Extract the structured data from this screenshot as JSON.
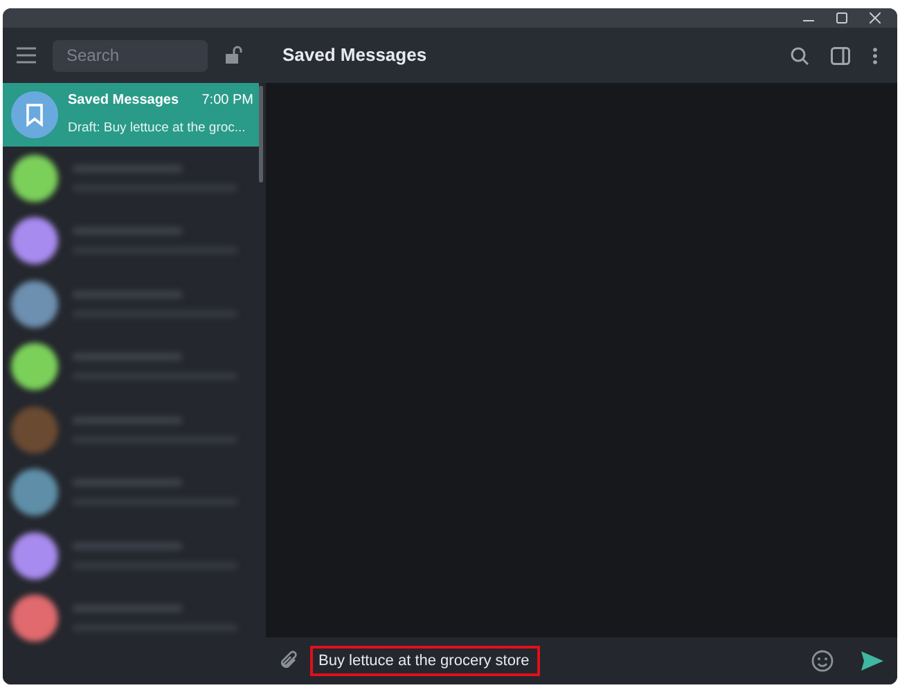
{
  "sidebar": {
    "search": {
      "placeholder": "Search"
    },
    "chats": [
      {
        "name": "Saved Messages",
        "time": "7:00 PM",
        "preview": "Draft: Buy lettuce at the groc...",
        "selected": true
      }
    ],
    "blurred_chats": [
      {
        "color": "#7bd05a"
      },
      {
        "color": "#a88bef"
      },
      {
        "color": "#6d8fb0"
      },
      {
        "color": "#7bd05a"
      },
      {
        "color": "#6b4a32"
      },
      {
        "color": "#5f8fa8"
      },
      {
        "color": "#a88bef"
      },
      {
        "color": "#e06a6e"
      }
    ]
  },
  "header": {
    "title": "Saved Messages"
  },
  "composer": {
    "value": "Buy lettuce at the grocery store",
    "highlighted": true
  }
}
